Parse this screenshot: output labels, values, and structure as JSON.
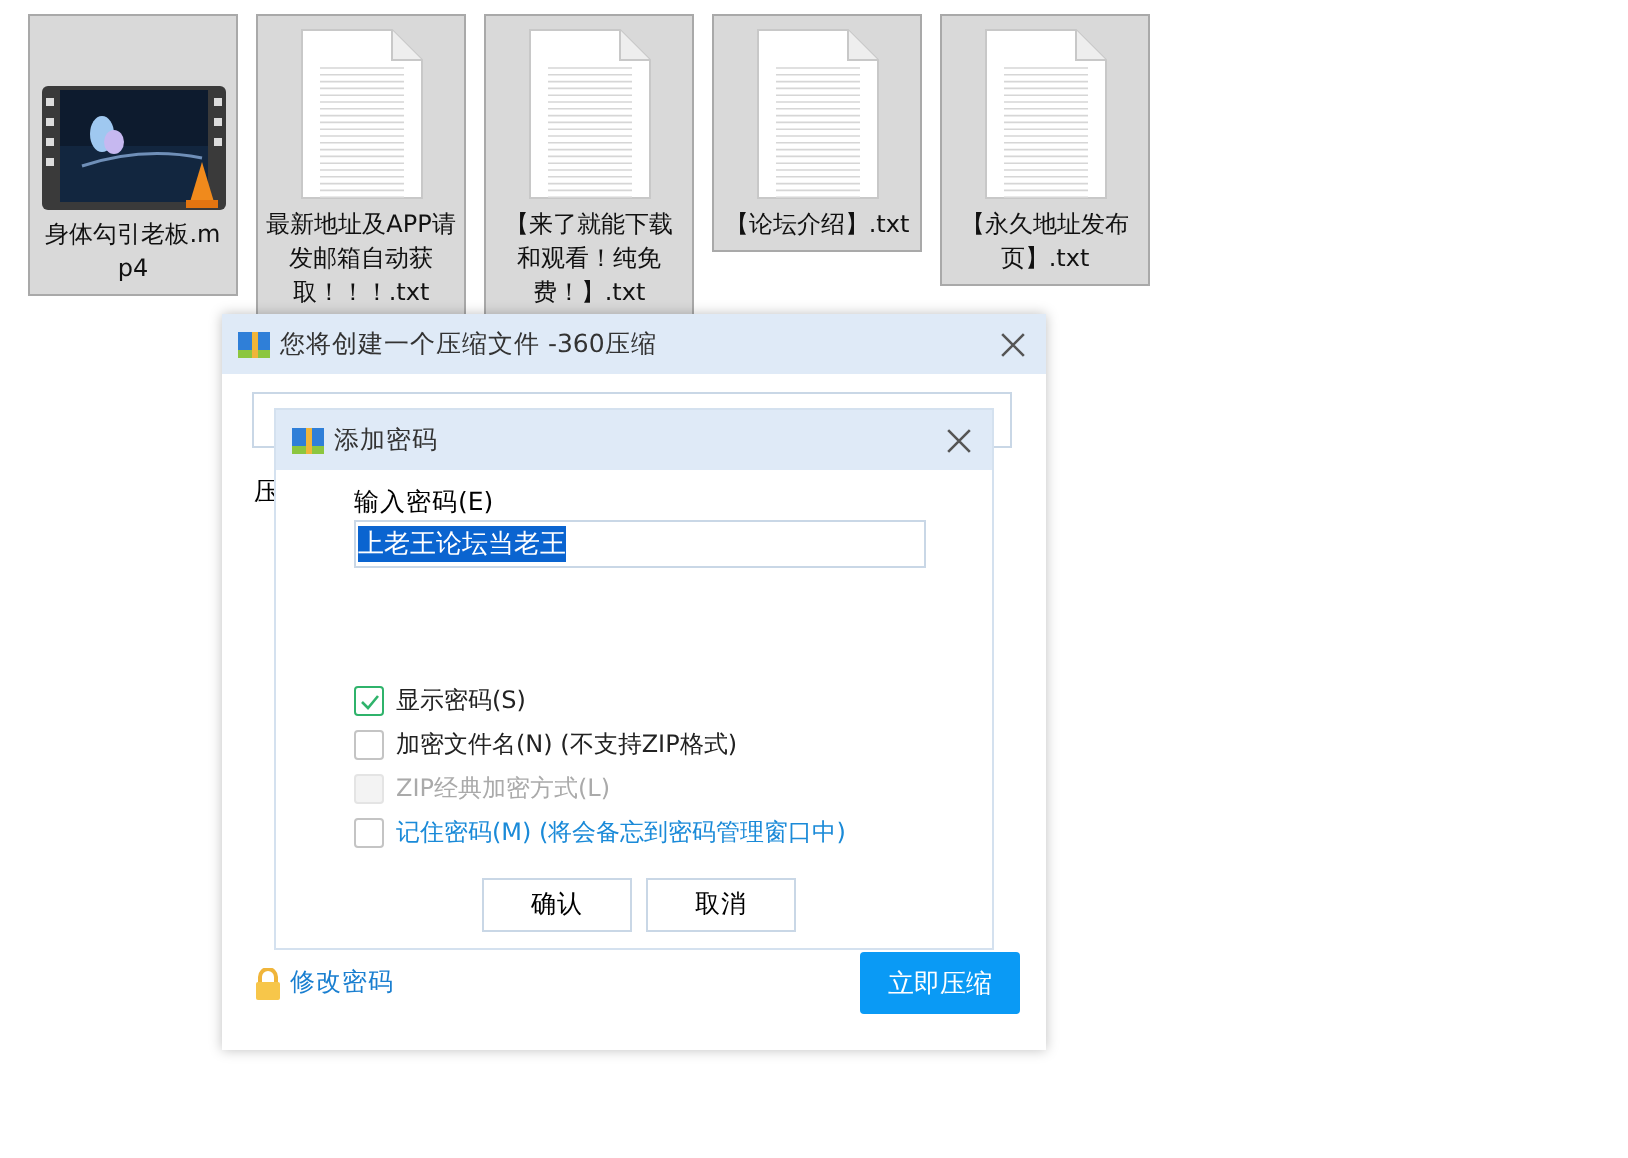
{
  "files": [
    {
      "name": "身体勾引老板.mp4",
      "kind": "video"
    },
    {
      "name": "最新地址及APP请发邮箱自动获取！！！.txt",
      "kind": "text"
    },
    {
      "name": "【来了就能下载和观看！纯免费！】.txt",
      "kind": "text"
    },
    {
      "name": "【论坛介绍】.txt",
      "kind": "text"
    },
    {
      "name": "【永久地址发布页】.txt",
      "kind": "text"
    }
  ],
  "compress_dialog": {
    "title": "您将创建一个压缩文件 -360压缩",
    "label": "压",
    "change_password_link": "修改密码",
    "compress_button": "立即压缩"
  },
  "password_dialog": {
    "title": "添加密码",
    "password_label": "输入密码(E)",
    "password_value": "上老王论坛当老王",
    "password_selected": true,
    "options": [
      {
        "label": "显示密码(S)",
        "checked": true,
        "disabled": false,
        "kind": "plain"
      },
      {
        "label": "加密文件名(N) (不支持ZIP格式)",
        "checked": false,
        "disabled": false,
        "kind": "plain"
      },
      {
        "label": "ZIP经典加密方式(L)",
        "checked": false,
        "disabled": true,
        "kind": "plain"
      },
      {
        "label": "记住密码(M) (将会备忘到密码管理窗口中)",
        "checked": false,
        "disabled": false,
        "kind": "link"
      }
    ],
    "buttons": [
      "确认",
      "取消"
    ]
  }
}
